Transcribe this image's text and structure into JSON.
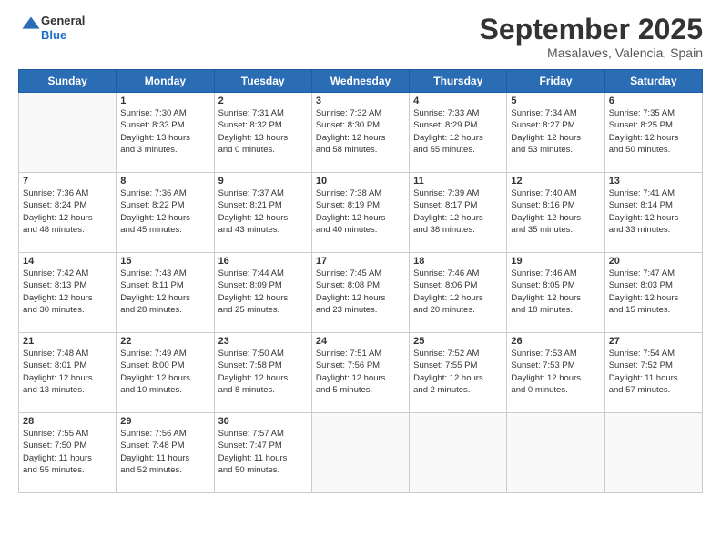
{
  "logo": {
    "general": "General",
    "blue": "Blue"
  },
  "header": {
    "month": "September 2025",
    "location": "Masalaves, Valencia, Spain"
  },
  "days": [
    "Sunday",
    "Monday",
    "Tuesday",
    "Wednesday",
    "Thursday",
    "Friday",
    "Saturday"
  ],
  "weeks": [
    [
      {
        "day": "",
        "info": ""
      },
      {
        "day": "1",
        "info": "Sunrise: 7:30 AM\nSunset: 8:33 PM\nDaylight: 13 hours\nand 3 minutes."
      },
      {
        "day": "2",
        "info": "Sunrise: 7:31 AM\nSunset: 8:32 PM\nDaylight: 13 hours\nand 0 minutes."
      },
      {
        "day": "3",
        "info": "Sunrise: 7:32 AM\nSunset: 8:30 PM\nDaylight: 12 hours\nand 58 minutes."
      },
      {
        "day": "4",
        "info": "Sunrise: 7:33 AM\nSunset: 8:29 PM\nDaylight: 12 hours\nand 55 minutes."
      },
      {
        "day": "5",
        "info": "Sunrise: 7:34 AM\nSunset: 8:27 PM\nDaylight: 12 hours\nand 53 minutes."
      },
      {
        "day": "6",
        "info": "Sunrise: 7:35 AM\nSunset: 8:25 PM\nDaylight: 12 hours\nand 50 minutes."
      }
    ],
    [
      {
        "day": "7",
        "info": "Sunrise: 7:36 AM\nSunset: 8:24 PM\nDaylight: 12 hours\nand 48 minutes."
      },
      {
        "day": "8",
        "info": "Sunrise: 7:36 AM\nSunset: 8:22 PM\nDaylight: 12 hours\nand 45 minutes."
      },
      {
        "day": "9",
        "info": "Sunrise: 7:37 AM\nSunset: 8:21 PM\nDaylight: 12 hours\nand 43 minutes."
      },
      {
        "day": "10",
        "info": "Sunrise: 7:38 AM\nSunset: 8:19 PM\nDaylight: 12 hours\nand 40 minutes."
      },
      {
        "day": "11",
        "info": "Sunrise: 7:39 AM\nSunset: 8:17 PM\nDaylight: 12 hours\nand 38 minutes."
      },
      {
        "day": "12",
        "info": "Sunrise: 7:40 AM\nSunset: 8:16 PM\nDaylight: 12 hours\nand 35 minutes."
      },
      {
        "day": "13",
        "info": "Sunrise: 7:41 AM\nSunset: 8:14 PM\nDaylight: 12 hours\nand 33 minutes."
      }
    ],
    [
      {
        "day": "14",
        "info": "Sunrise: 7:42 AM\nSunset: 8:13 PM\nDaylight: 12 hours\nand 30 minutes."
      },
      {
        "day": "15",
        "info": "Sunrise: 7:43 AM\nSunset: 8:11 PM\nDaylight: 12 hours\nand 28 minutes."
      },
      {
        "day": "16",
        "info": "Sunrise: 7:44 AM\nSunset: 8:09 PM\nDaylight: 12 hours\nand 25 minutes."
      },
      {
        "day": "17",
        "info": "Sunrise: 7:45 AM\nSunset: 8:08 PM\nDaylight: 12 hours\nand 23 minutes."
      },
      {
        "day": "18",
        "info": "Sunrise: 7:46 AM\nSunset: 8:06 PM\nDaylight: 12 hours\nand 20 minutes."
      },
      {
        "day": "19",
        "info": "Sunrise: 7:46 AM\nSunset: 8:05 PM\nDaylight: 12 hours\nand 18 minutes."
      },
      {
        "day": "20",
        "info": "Sunrise: 7:47 AM\nSunset: 8:03 PM\nDaylight: 12 hours\nand 15 minutes."
      }
    ],
    [
      {
        "day": "21",
        "info": "Sunrise: 7:48 AM\nSunset: 8:01 PM\nDaylight: 12 hours\nand 13 minutes."
      },
      {
        "day": "22",
        "info": "Sunrise: 7:49 AM\nSunset: 8:00 PM\nDaylight: 12 hours\nand 10 minutes."
      },
      {
        "day": "23",
        "info": "Sunrise: 7:50 AM\nSunset: 7:58 PM\nDaylight: 12 hours\nand 8 minutes."
      },
      {
        "day": "24",
        "info": "Sunrise: 7:51 AM\nSunset: 7:56 PM\nDaylight: 12 hours\nand 5 minutes."
      },
      {
        "day": "25",
        "info": "Sunrise: 7:52 AM\nSunset: 7:55 PM\nDaylight: 12 hours\nand 2 minutes."
      },
      {
        "day": "26",
        "info": "Sunrise: 7:53 AM\nSunset: 7:53 PM\nDaylight: 12 hours\nand 0 minutes."
      },
      {
        "day": "27",
        "info": "Sunrise: 7:54 AM\nSunset: 7:52 PM\nDaylight: 11 hours\nand 57 minutes."
      }
    ],
    [
      {
        "day": "28",
        "info": "Sunrise: 7:55 AM\nSunset: 7:50 PM\nDaylight: 11 hours\nand 55 minutes."
      },
      {
        "day": "29",
        "info": "Sunrise: 7:56 AM\nSunset: 7:48 PM\nDaylight: 11 hours\nand 52 minutes."
      },
      {
        "day": "30",
        "info": "Sunrise: 7:57 AM\nSunset: 7:47 PM\nDaylight: 11 hours\nand 50 minutes."
      },
      {
        "day": "",
        "info": ""
      },
      {
        "day": "",
        "info": ""
      },
      {
        "day": "",
        "info": ""
      },
      {
        "day": "",
        "info": ""
      }
    ]
  ]
}
